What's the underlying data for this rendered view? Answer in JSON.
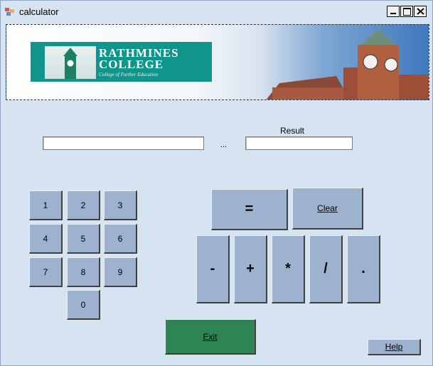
{
  "window": {
    "title": "calculator"
  },
  "inputs": {
    "operand_value": "",
    "result_value": ""
  },
  "labels": {
    "ellipsis": "...",
    "result": "Result"
  },
  "banner": {
    "logo_line1": "RATHMINES",
    "logo_line2": "COLLEGE",
    "logo_sub": "College of Further Education"
  },
  "digits": [
    "1",
    "2",
    "3",
    "4",
    "5",
    "6",
    "7",
    "8",
    "9",
    "0"
  ],
  "operators": {
    "equals": "=",
    "minus": "-",
    "plus": "+",
    "multiply": "*",
    "divide": "/",
    "dot": "."
  },
  "actions": {
    "clear": "Clear",
    "exit": "Exit",
    "help": "Help"
  },
  "colors": {
    "button": "#9db2cf",
    "exit_button": "#2e8454",
    "background": "#d6e3f1",
    "logo_teal": "#0f958b"
  }
}
